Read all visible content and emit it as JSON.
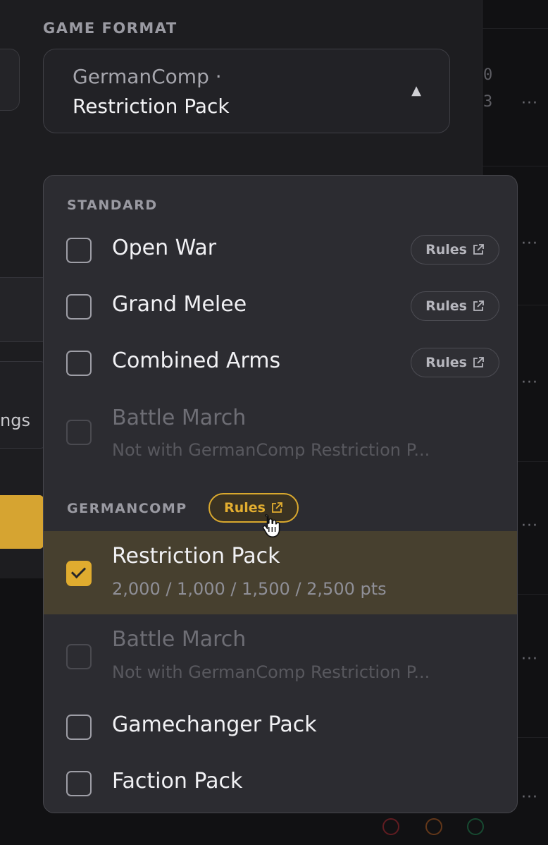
{
  "game_format": {
    "heading": "GAME FORMAT",
    "selected_line1": "GermanComp ·",
    "selected_line2": "Restriction Pack",
    "caret_icon": "caret-up-icon"
  },
  "background": {
    "settings_text": "ngs",
    "digits": [
      "0",
      "3"
    ]
  },
  "dropdown": {
    "groups": [
      {
        "header": "STANDARD",
        "options": [
          {
            "label": "Open War",
            "rules": "Rules"
          },
          {
            "label": "Grand Melee",
            "rules": "Rules"
          },
          {
            "label": "Combined Arms",
            "rules": "Rules"
          },
          {
            "label": "Battle March",
            "sub": "Not with GermanComp Restriction P..."
          }
        ]
      },
      {
        "header": "GERMANCOMP",
        "rules": "Rules",
        "options": [
          {
            "label": "Restriction Pack",
            "sub": "2,000 / 1,000 / 1,500 / 2,500 pts",
            "checked": true
          },
          {
            "label": "Battle March",
            "sub": "Not with GermanComp Restriction P..."
          },
          {
            "label": "Gamechanger Pack"
          },
          {
            "label": "Faction Pack"
          }
        ]
      }
    ]
  },
  "colors": {
    "accent": "#e0ac2f",
    "selected_row": "#47402f",
    "panel": "#2c2c31"
  }
}
